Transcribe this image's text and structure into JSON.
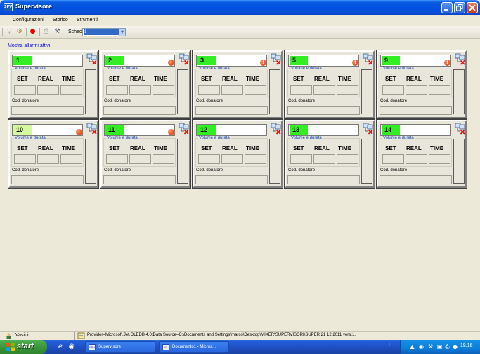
{
  "window": {
    "title": "Supervisore",
    "app_icon": "SPV"
  },
  "menu": [
    "Configurazioni",
    "Storico",
    "Strumenti"
  ],
  "toolbar": {
    "scheda_label": "Scheda",
    "scheda_value": "1"
  },
  "alarms_link": "Mostra allarmi attivi",
  "panel_labels": {
    "group": "Volume e durata",
    "set": "SET",
    "real": "REAL",
    "time": "TIME",
    "donor": "Cod. donatore"
  },
  "panels": [
    {
      "id": "1",
      "warning": false,
      "active": true
    },
    {
      "id": "2",
      "warning": true,
      "active": true
    },
    {
      "id": "3",
      "warning": true,
      "active": true
    },
    {
      "id": "5",
      "warning": true,
      "active": true
    },
    {
      "id": "9",
      "warning": true,
      "active": true
    },
    {
      "id": "10",
      "warning": true,
      "active": false
    },
    {
      "id": "11",
      "warning": true,
      "active": true
    },
    {
      "id": "12",
      "warning": false,
      "active": true
    },
    {
      "id": "13",
      "warning": false,
      "active": true
    },
    {
      "id": "14",
      "warning": false,
      "active": true
    }
  ],
  "status": {
    "user": "Vasini",
    "connection": "Provider=Microsoft.Jet.OLEDB.4.0;Data Source=C:\\Documents and Settings\\marco\\Desktop\\MIXER\\SUPERVISORI\\SUPER 21 12 2011 vers.1."
  },
  "taskbar": {
    "start": "start",
    "tasks": [
      {
        "label": "Supervisore",
        "icon": "SPV"
      },
      {
        "label": "Documento1 - Micros...",
        "icon": "W"
      }
    ],
    "language": "IT",
    "clock": "18.16"
  },
  "colors": {
    "active_id": "#33ee22",
    "inactive_id": "#d4f7a0",
    "title_blue": "#0053e1",
    "warning_red": "#d23000"
  }
}
